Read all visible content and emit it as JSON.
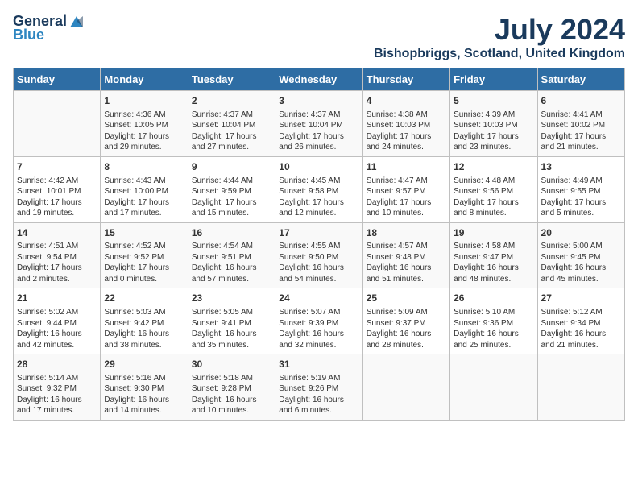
{
  "logo": {
    "general": "General",
    "blue": "Blue"
  },
  "title": "July 2024",
  "location": "Bishopbriggs, Scotland, United Kingdom",
  "days_header": [
    "Sunday",
    "Monday",
    "Tuesday",
    "Wednesday",
    "Thursday",
    "Friday",
    "Saturday"
  ],
  "weeks": [
    [
      {
        "day": "",
        "content": ""
      },
      {
        "day": "1",
        "content": "Sunrise: 4:36 AM\nSunset: 10:05 PM\nDaylight: 17 hours\nand 29 minutes."
      },
      {
        "day": "2",
        "content": "Sunrise: 4:37 AM\nSunset: 10:04 PM\nDaylight: 17 hours\nand 27 minutes."
      },
      {
        "day": "3",
        "content": "Sunrise: 4:37 AM\nSunset: 10:04 PM\nDaylight: 17 hours\nand 26 minutes."
      },
      {
        "day": "4",
        "content": "Sunrise: 4:38 AM\nSunset: 10:03 PM\nDaylight: 17 hours\nand 24 minutes."
      },
      {
        "day": "5",
        "content": "Sunrise: 4:39 AM\nSunset: 10:03 PM\nDaylight: 17 hours\nand 23 minutes."
      },
      {
        "day": "6",
        "content": "Sunrise: 4:41 AM\nSunset: 10:02 PM\nDaylight: 17 hours\nand 21 minutes."
      }
    ],
    [
      {
        "day": "7",
        "content": "Sunrise: 4:42 AM\nSunset: 10:01 PM\nDaylight: 17 hours\nand 19 minutes."
      },
      {
        "day": "8",
        "content": "Sunrise: 4:43 AM\nSunset: 10:00 PM\nDaylight: 17 hours\nand 17 minutes."
      },
      {
        "day": "9",
        "content": "Sunrise: 4:44 AM\nSunset: 9:59 PM\nDaylight: 17 hours\nand 15 minutes."
      },
      {
        "day": "10",
        "content": "Sunrise: 4:45 AM\nSunset: 9:58 PM\nDaylight: 17 hours\nand 12 minutes."
      },
      {
        "day": "11",
        "content": "Sunrise: 4:47 AM\nSunset: 9:57 PM\nDaylight: 17 hours\nand 10 minutes."
      },
      {
        "day": "12",
        "content": "Sunrise: 4:48 AM\nSunset: 9:56 PM\nDaylight: 17 hours\nand 8 minutes."
      },
      {
        "day": "13",
        "content": "Sunrise: 4:49 AM\nSunset: 9:55 PM\nDaylight: 17 hours\nand 5 minutes."
      }
    ],
    [
      {
        "day": "14",
        "content": "Sunrise: 4:51 AM\nSunset: 9:54 PM\nDaylight: 17 hours\nand 2 minutes."
      },
      {
        "day": "15",
        "content": "Sunrise: 4:52 AM\nSunset: 9:52 PM\nDaylight: 17 hours\nand 0 minutes."
      },
      {
        "day": "16",
        "content": "Sunrise: 4:54 AM\nSunset: 9:51 PM\nDaylight: 16 hours\nand 57 minutes."
      },
      {
        "day": "17",
        "content": "Sunrise: 4:55 AM\nSunset: 9:50 PM\nDaylight: 16 hours\nand 54 minutes."
      },
      {
        "day": "18",
        "content": "Sunrise: 4:57 AM\nSunset: 9:48 PM\nDaylight: 16 hours\nand 51 minutes."
      },
      {
        "day": "19",
        "content": "Sunrise: 4:58 AM\nSunset: 9:47 PM\nDaylight: 16 hours\nand 48 minutes."
      },
      {
        "day": "20",
        "content": "Sunrise: 5:00 AM\nSunset: 9:45 PM\nDaylight: 16 hours\nand 45 minutes."
      }
    ],
    [
      {
        "day": "21",
        "content": "Sunrise: 5:02 AM\nSunset: 9:44 PM\nDaylight: 16 hours\nand 42 minutes."
      },
      {
        "day": "22",
        "content": "Sunrise: 5:03 AM\nSunset: 9:42 PM\nDaylight: 16 hours\nand 38 minutes."
      },
      {
        "day": "23",
        "content": "Sunrise: 5:05 AM\nSunset: 9:41 PM\nDaylight: 16 hours\nand 35 minutes."
      },
      {
        "day": "24",
        "content": "Sunrise: 5:07 AM\nSunset: 9:39 PM\nDaylight: 16 hours\nand 32 minutes."
      },
      {
        "day": "25",
        "content": "Sunrise: 5:09 AM\nSunset: 9:37 PM\nDaylight: 16 hours\nand 28 minutes."
      },
      {
        "day": "26",
        "content": "Sunrise: 5:10 AM\nSunset: 9:36 PM\nDaylight: 16 hours\nand 25 minutes."
      },
      {
        "day": "27",
        "content": "Sunrise: 5:12 AM\nSunset: 9:34 PM\nDaylight: 16 hours\nand 21 minutes."
      }
    ],
    [
      {
        "day": "28",
        "content": "Sunrise: 5:14 AM\nSunset: 9:32 PM\nDaylight: 16 hours\nand 17 minutes."
      },
      {
        "day": "29",
        "content": "Sunrise: 5:16 AM\nSunset: 9:30 PM\nDaylight: 16 hours\nand 14 minutes."
      },
      {
        "day": "30",
        "content": "Sunrise: 5:18 AM\nSunset: 9:28 PM\nDaylight: 16 hours\nand 10 minutes."
      },
      {
        "day": "31",
        "content": "Sunrise: 5:19 AM\nSunset: 9:26 PM\nDaylight: 16 hours\nand 6 minutes."
      },
      {
        "day": "",
        "content": ""
      },
      {
        "day": "",
        "content": ""
      },
      {
        "day": "",
        "content": ""
      }
    ]
  ]
}
